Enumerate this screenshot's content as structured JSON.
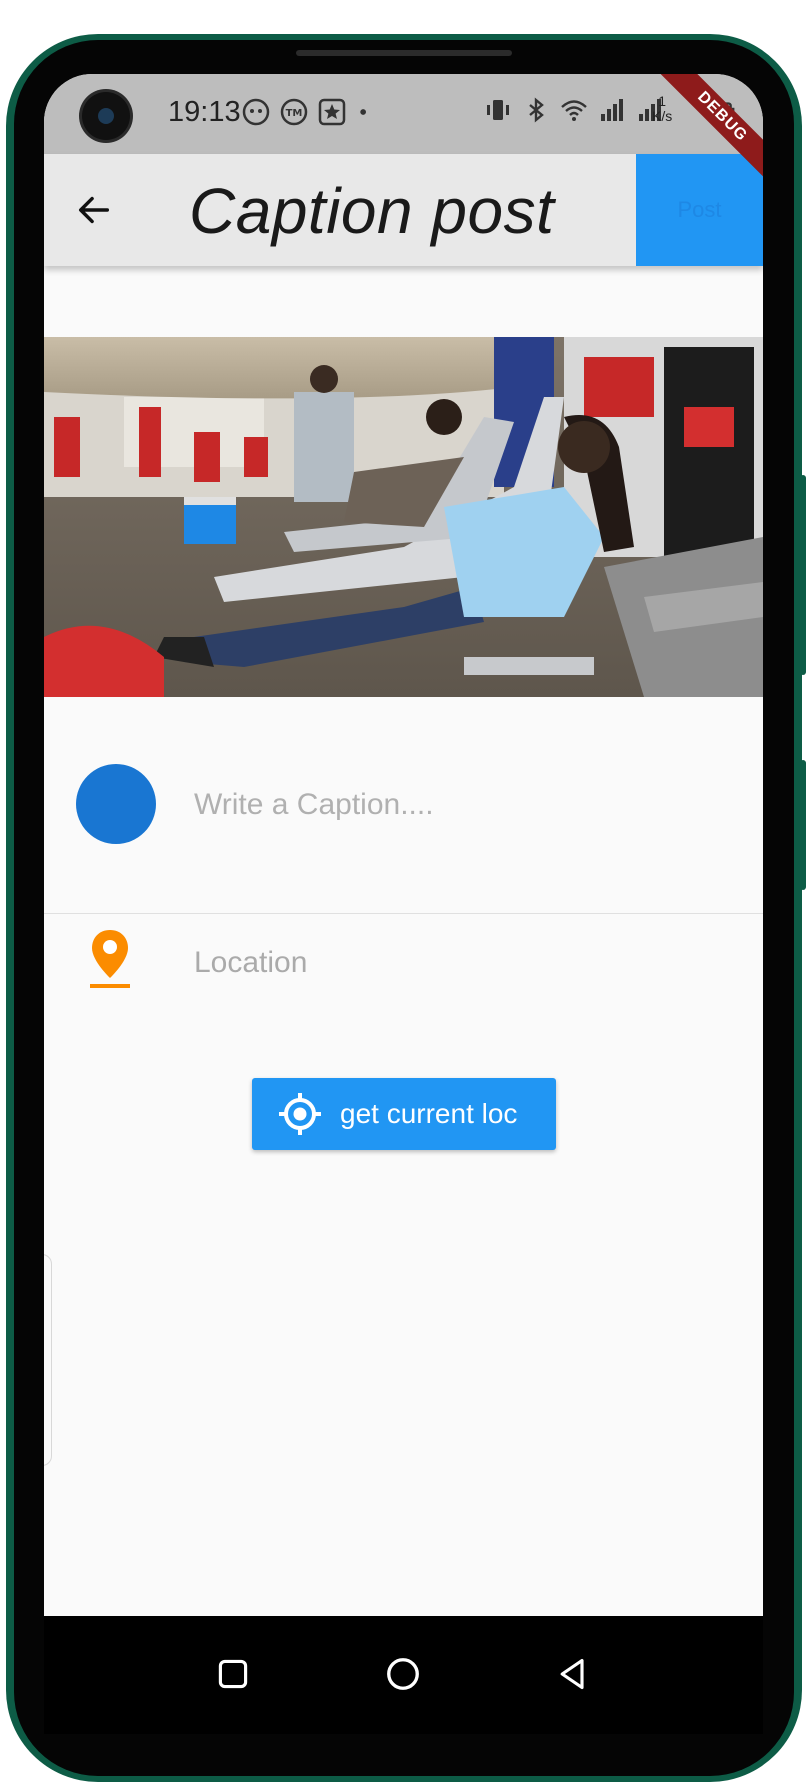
{
  "status_bar": {
    "time": "19:13",
    "net_speed_value": "1",
    "net_speed_unit": "K/s",
    "debug_banner": "DEBUG"
  },
  "app_bar": {
    "title": "Caption post",
    "post_label": "Post"
  },
  "caption": {
    "placeholder": "Write a Caption...."
  },
  "location": {
    "placeholder": "Location"
  },
  "get_location_button": {
    "label": "get current loc"
  },
  "colors": {
    "primary": "#2196f3",
    "avatar": "#1976d2",
    "pin": "#fb8c00",
    "frame": "#0d5c46"
  },
  "icons": {
    "back": "arrow-left-icon",
    "pin": "location-pin-icon",
    "gps": "gps-fixed-icon",
    "nav_recents": "square-icon",
    "nav_home": "circle-icon",
    "nav_back": "triangle-back-icon"
  }
}
